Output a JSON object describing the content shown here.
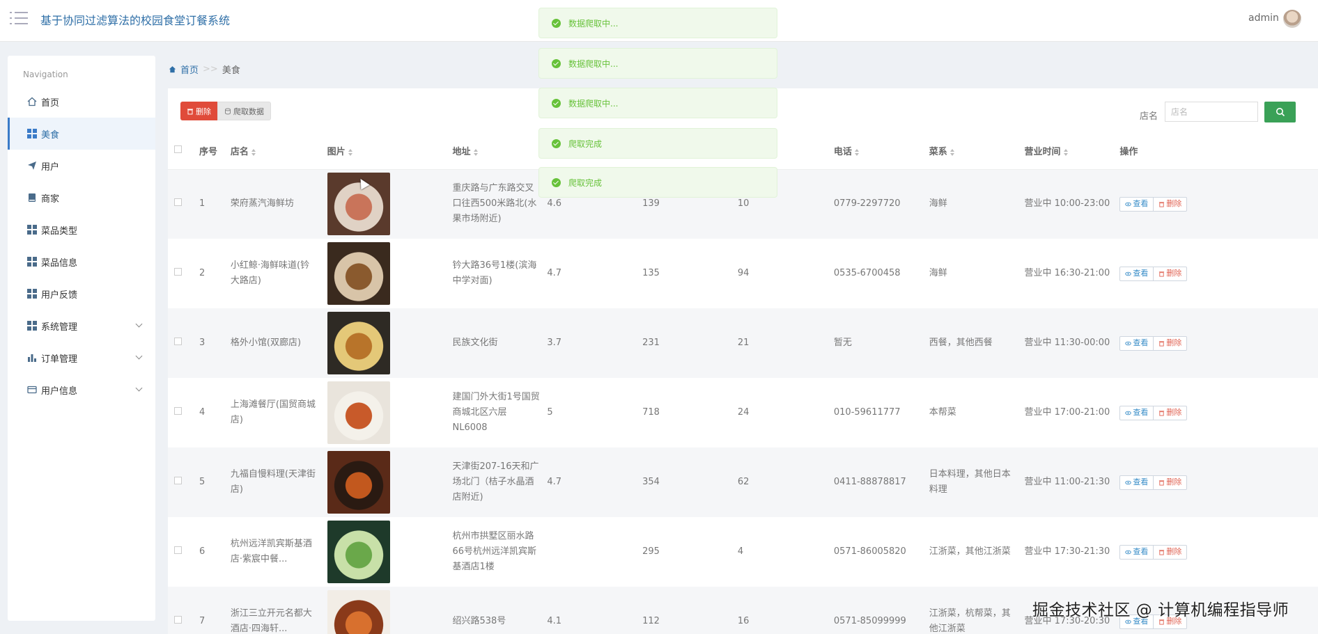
{
  "header": {
    "title": "基于协同过滤算法的校园食堂订餐系统",
    "user": "admin"
  },
  "sidebar": {
    "caption": "Navigation",
    "items": [
      {
        "label": "首页",
        "icon": "home-icon"
      },
      {
        "label": "美食",
        "icon": "grid-icon",
        "active": true
      },
      {
        "label": "用户",
        "icon": "send-icon"
      },
      {
        "label": "商家",
        "icon": "bookmark-icon"
      },
      {
        "label": "菜品类型",
        "icon": "grid-icon"
      },
      {
        "label": "菜品信息",
        "icon": "grid-icon"
      },
      {
        "label": "用户反馈",
        "icon": "grid-icon"
      },
      {
        "label": "系统管理",
        "icon": "grid-icon",
        "expandable": true
      },
      {
        "label": "订单管理",
        "icon": "bar-chart-icon",
        "expandable": true
      },
      {
        "label": "用户信息",
        "icon": "card-icon",
        "expandable": true
      }
    ]
  },
  "breadcrumb": {
    "home": "首页",
    "sep": ">>",
    "current": "美食"
  },
  "toolbar": {
    "delete_label": "删除",
    "crawl_label": "爬取数据",
    "search_label": "店名",
    "search_placeholder": "店名"
  },
  "toasts": [
    "数据爬取中...",
    "数据爬取中...",
    "数据爬取中...",
    "爬取完成",
    "爬取完成"
  ],
  "table": {
    "headers": {
      "no": "序号",
      "name": "店名",
      "image": "图片",
      "address": "地址",
      "phone": "电话",
      "cuisine": "菜系",
      "hours": "营业时间",
      "ops": "操作"
    },
    "view_label": "查看",
    "delete_label": "删除",
    "rows": [
      {
        "no": "1",
        "name": "荣府蒸汽海鲜坊",
        "address": "重庆路与广东路交叉口往西500米路北(水果市场附近)",
        "score": "4.6",
        "c1": "139",
        "c2": "10",
        "phone": "0779-2297720",
        "cuisine": "海鲜",
        "hours": "营业中 10:00-23:00",
        "img": [
          "#5a3a2c",
          "#c9745a",
          "#e0d2c5"
        ]
      },
      {
        "no": "2",
        "name": "小红鲸·海鲜味道(钤大路店)",
        "address": "钤大路36号1楼(滨海中学对面)",
        "score": "4.7",
        "c1": "135",
        "c2": "94",
        "phone": "0535-6700458",
        "cuisine": "海鲜",
        "hours": "营业中 16:30-21:00",
        "img": [
          "#3a2a1e",
          "#8a5a2e",
          "#d8c4a8"
        ]
      },
      {
        "no": "3",
        "name": "格外小馆(双廊店)",
        "address": "民族文化街",
        "score": "3.7",
        "c1": "231",
        "c2": "21",
        "phone": "暂无",
        "cuisine": "西餐，其他西餐",
        "hours": "营业中 11:30-00:00",
        "img": [
          "#2e2a24",
          "#b8742a",
          "#e4c878"
        ]
      },
      {
        "no": "4",
        "name": "上海滩餐厅(国贸商城店)",
        "address": "建国门外大街1号国贸商城北区六层NL6008",
        "score": "5",
        "c1": "718",
        "c2": "24",
        "phone": "010-59611777",
        "cuisine": "本帮菜",
        "hours": "营业中 17:00-21:00",
        "img": [
          "#e9e4dc",
          "#c85a2a",
          "#f4f1ea"
        ]
      },
      {
        "no": "5",
        "name": "九福自慢料理(天津街店)",
        "address": "天津街207-16天和广场北门（桔子水晶酒店附近)",
        "score": "4.7",
        "c1": "354",
        "c2": "62",
        "phone": "0411-88878817",
        "cuisine": "日本料理，其他日本料理",
        "hours": "营业中 11:00-21:30",
        "img": [
          "#5a2a18",
          "#c2581e",
          "#2a1a12"
        ]
      },
      {
        "no": "6",
        "name": "杭州远洋凯宾斯基酒店·紫宸中餐...",
        "address": "杭州市拱墅区丽水路66号杭州远洋凯宾斯基酒店1楼",
        "score": "",
        "c1": "295",
        "c2": "4",
        "phone": "0571-86005820",
        "cuisine": "江浙菜，其他江浙菜",
        "hours": "营业中 17:30-21:30",
        "img": [
          "#1e3a2a",
          "#6aa84a",
          "#c8e0a8"
        ]
      },
      {
        "no": "7",
        "name": "浙江三立开元名都大酒店·四海轩...",
        "address": "绍兴路538号",
        "score": "4.1",
        "c1": "112",
        "c2": "16",
        "phone": "0571-85099999",
        "cuisine": "江浙菜，杭帮菜，其他江浙菜",
        "hours": "营业中 17:30-20:30",
        "img": [
          "#f2ede6",
          "#d8702e",
          "#8a3a1a"
        ]
      }
    ]
  },
  "watermark": "掘金技术社区 @ 计算机编程指导师",
  "colors": {
    "primary": "#2f6fa7",
    "danger": "#e04b3a",
    "success": "#3aa157",
    "toast_text": "#67c23a"
  }
}
